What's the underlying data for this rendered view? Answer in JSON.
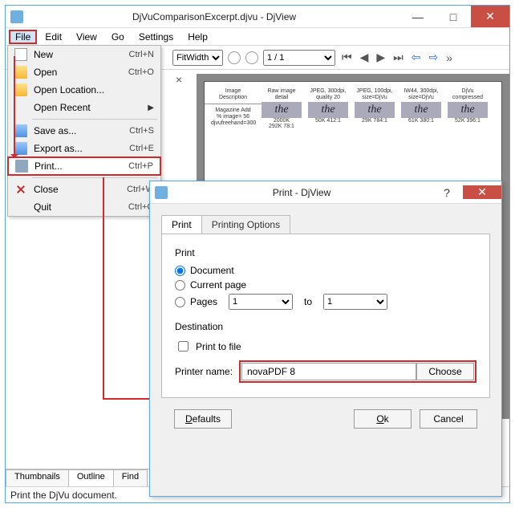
{
  "window": {
    "title": "DjVuComparisonExcerpt.djvu - DjView",
    "min": "—",
    "max": "□",
    "close": "✕"
  },
  "menubar": [
    "File",
    "Edit",
    "View",
    "Go",
    "Settings",
    "Help"
  ],
  "toolbar": {
    "zoom_mode": "FitWidth",
    "page_display": "1 / 1"
  },
  "filemenu": {
    "new": "New",
    "new_sc": "Ctrl+N",
    "open": "Open",
    "open_sc": "Ctrl+O",
    "open_loc": "Open Location...",
    "open_recent": "Open Recent",
    "save_as": "Save as...",
    "save_as_sc": "Ctrl+S",
    "export_as": "Export as...",
    "export_as_sc": "Ctrl+E",
    "print": "Print...",
    "print_sc": "Ctrl+P",
    "close": "Close",
    "close_sc": "Ctrl+W",
    "quit": "Quit",
    "quit_sc": "Ctrl+Q"
  },
  "doc": {
    "col0a": "Image Description",
    "col0b": "Magazine Add",
    "col0c": "% image= 56",
    "col0d": "djvufreehand=300",
    "c1": "Raw image detail",
    "c1b": "292K 78:1",
    "c2": "JPEG, 300dpi, quality 20",
    "c2b": "50K 412:1",
    "c3": "JPEG, 100dpi, size=DjVu",
    "c3b": "29K 784:1",
    "c4": "IW44, 300dpi, size=DjVu",
    "c4b": "61K 380:1",
    "c5": "DjVu compressed",
    "c5b": "52K 396:1",
    "the": "the",
    "size": "2000K"
  },
  "tabs": {
    "thumbnails": "Thumbnails",
    "outline": "Outline",
    "find": "Find"
  },
  "status": "Print the DjVu document.",
  "dialog": {
    "title": "Print - DjView",
    "help": "?",
    "close": "✕",
    "tab_print": "Print",
    "tab_options": "Printing Options",
    "group_print": "Print",
    "r_document": "Document",
    "r_current": "Current page",
    "r_pages": "Pages",
    "page_from": "1",
    "to": "to",
    "page_to": "1",
    "group_dest": "Destination",
    "print_to_file": "Print to file",
    "printer_label": "Printer name:",
    "printer_value": "novaPDF 8",
    "choose": "Choose",
    "defaults": "Defaults",
    "ok": "Ok",
    "cancel": "Cancel"
  }
}
